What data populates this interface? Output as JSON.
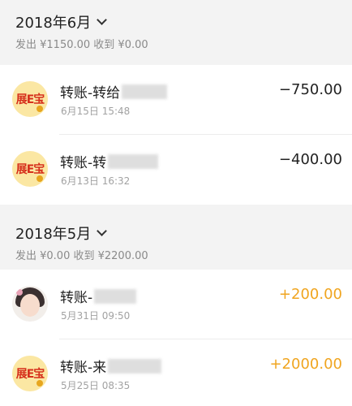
{
  "sections": [
    {
      "title": "2018年6月",
      "summary": "发出 ¥1150.00 收到 ¥0.00",
      "transactions": [
        {
          "title": "转账-转给",
          "time": "6月15日 15:48",
          "amount": "−750.00",
          "avatar": "展E宝",
          "direction": "out",
          "obscured": true
        },
        {
          "title": "转账-转",
          "time": "6月13日 16:32",
          "amount": "−400.00",
          "avatar": "展E宝",
          "direction": "out",
          "obscured": true
        }
      ]
    },
    {
      "title": "2018年5月",
      "summary": "发出 ¥0.00 收到 ¥2200.00",
      "transactions": [
        {
          "title": "转账-",
          "time": "5月31日 09:50",
          "amount": "+200.00",
          "avatar": "photo",
          "direction": "in",
          "obscured": true
        },
        {
          "title": "转账-来",
          "time": "5月25日 08:35",
          "amount": "+2000.00",
          "avatar": "展E宝",
          "direction": "in",
          "obscured": true
        }
      ]
    }
  ],
  "colors": {
    "header_bg": "#f3f3f3",
    "income": "#f0a520",
    "expense": "#222222",
    "logo_red": "#d6301c",
    "logo_bg": "#fbe7a3"
  },
  "icons": {
    "month_toggle": "chevron-down-icon"
  }
}
